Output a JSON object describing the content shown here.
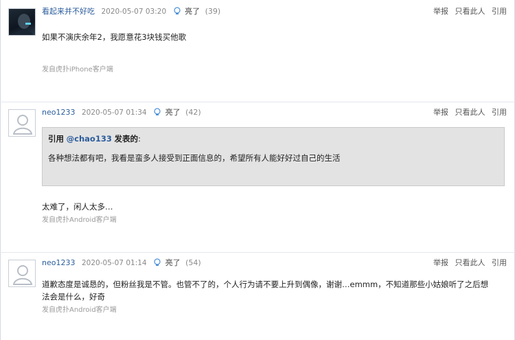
{
  "actions": {
    "report": "举报",
    "only_this_user": "只看此人",
    "quote": "引用"
  },
  "posts": [
    {
      "username": "看起来并不好吃",
      "timestamp": "2020-05-07 03:20",
      "light_label": "亮了",
      "light_count": "(39)",
      "content": "如果不演庆余年2，我愿意花3块钱买他歌",
      "source": "发自虎扑iPhone客户端"
    },
    {
      "username": "neo1233",
      "timestamp": "2020-05-07 01:34",
      "light_label": "亮了",
      "light_count": "(42)",
      "quote": {
        "prefix": "引用",
        "user": "@chao133",
        "suffix": "发表的",
        "colon": ":",
        "body": "各种想法都有吧，我看是蛮多人接受到正面信息的，希望所有人能好好过自己的生活"
      },
      "content": "太难了，闲人太多…",
      "source": "发自虎扑Android客户端"
    },
    {
      "username": "neo1233",
      "timestamp": "2020-05-07 01:14",
      "light_label": "亮了",
      "light_count": "(54)",
      "content_line1": "道歉态度是诚恳的，但粉丝我是不管。也管不了的，个人行为请不要上升到偶像，谢谢…emmm，不知道那些小姑娘听了之后想",
      "content_line2": "法会是什么，好奇",
      "source": "发自虎扑Android客户端"
    }
  ]
}
